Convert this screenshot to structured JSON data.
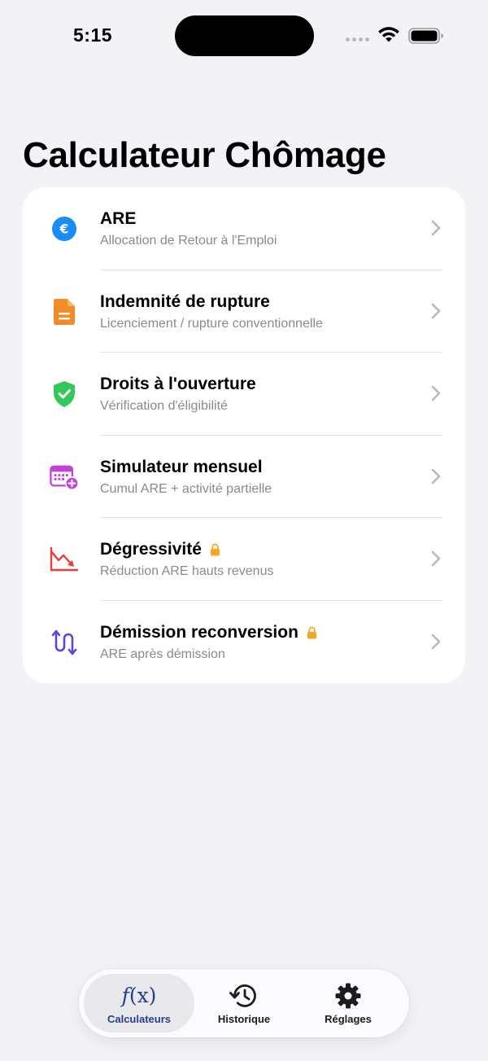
{
  "status_bar": {
    "time": "5:15"
  },
  "page": {
    "title": "Calculateur Chômage"
  },
  "calculators": [
    {
      "title": "ARE",
      "subtitle": "Allocation de Retour à l'Emploi",
      "icon": "euro-icon",
      "color": "#1a8cf5",
      "locked": false
    },
    {
      "title": "Indemnité de rupture",
      "subtitle": "Licenciement / rupture conventionnelle",
      "icon": "document-icon",
      "color": "#f28c28",
      "locked": false
    },
    {
      "title": "Droits à l'ouverture",
      "subtitle": "Vérification d'éligibilité",
      "icon": "shield-check-icon",
      "color": "#34c759",
      "locked": false
    },
    {
      "title": "Simulateur mensuel",
      "subtitle": "Cumul ARE + activité partielle",
      "icon": "calendar-add-icon",
      "color": "#c043d6",
      "locked": false
    },
    {
      "title": "Dégressivité",
      "subtitle": "Réduction ARE hauts revenus",
      "icon": "chart-down-icon",
      "color": "#ef3b3b",
      "locked": true
    },
    {
      "title": "Démission reconversion",
      "subtitle": "ARE après démission",
      "icon": "arrows-swap-icon",
      "color": "#5b48d6",
      "locked": true
    }
  ],
  "tab_bar": {
    "tabs": [
      {
        "label": "Calculateurs",
        "icon": "fx-icon",
        "active": true
      },
      {
        "label": "Historique",
        "icon": "history-icon",
        "active": false
      },
      {
        "label": "Réglages",
        "icon": "gear-icon",
        "active": false
      }
    ],
    "fx_symbol": "(x)",
    "fx_f": "f"
  },
  "colors": {
    "background": "#f2f2f7",
    "accent": "#24418c",
    "lock": "#f5a623"
  }
}
